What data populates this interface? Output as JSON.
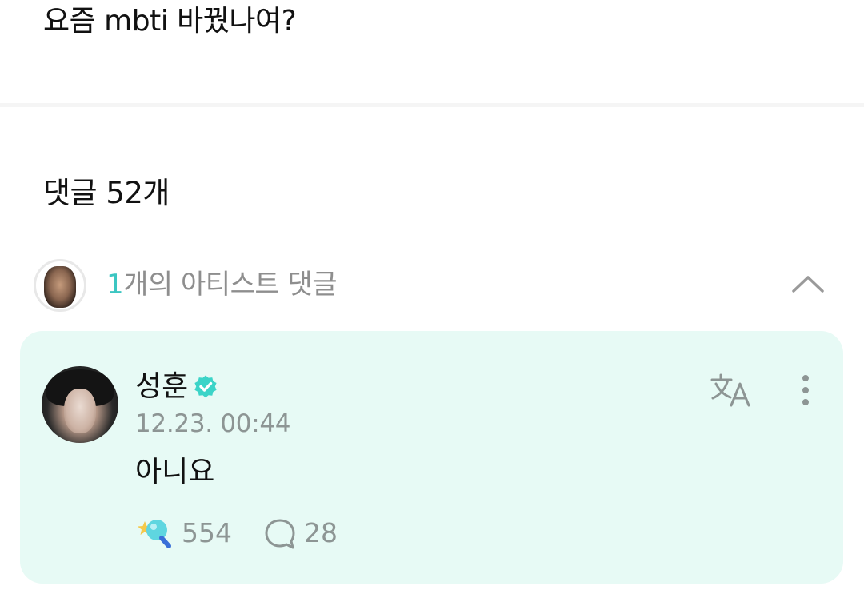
{
  "post": {
    "text": "요즘 mbti 바꿨나여?"
  },
  "comments_header": {
    "label": "댓글 52개"
  },
  "artist_comments": {
    "count": "1",
    "label": "개의 아티스트 댓글",
    "collapse_icon": "chevron-up-icon"
  },
  "comment": {
    "author": "성훈",
    "verified_icon": "verified-badge-icon",
    "timestamp": "12.23. 00:44",
    "body": "아니요",
    "translate_icon": "translate-icon",
    "more_icon": "more-vertical-icon",
    "reactions": {
      "icon": "lightstick-reaction-icon",
      "count": "554"
    },
    "replies": {
      "icon": "speech-bubble-icon",
      "count": "28"
    }
  },
  "colors": {
    "accent": "#3cc6c2",
    "card_background": "#e7faf5",
    "muted_text": "#8d9594",
    "verified": "#3cd4c8"
  }
}
